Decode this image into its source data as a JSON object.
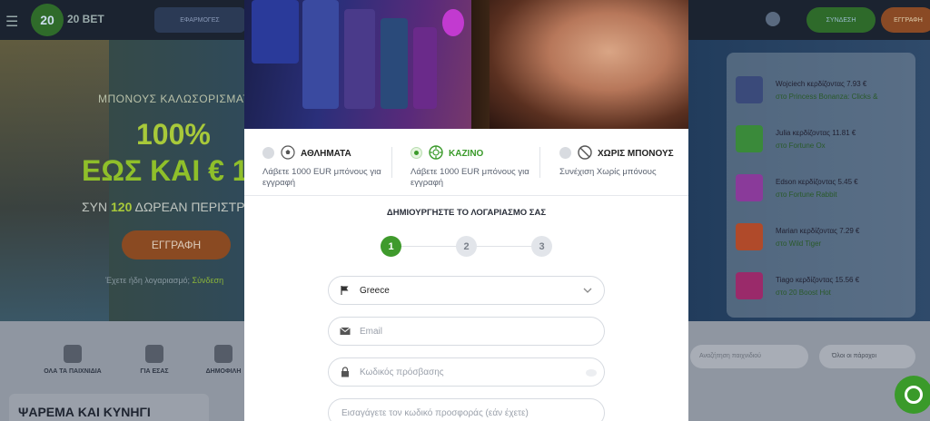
{
  "background": {
    "logo_text": "20 BET",
    "nav_label": "ΕΦΑΡΜΟΓΕΣ",
    "login_label": "ΣΥΝΔΕΣΗ",
    "register_label": "ΕΓΓΡΑΦΗ",
    "hero": {
      "title": "ΜΠΟΝΟΥΣ ΚΑΛΩΣΟΡΙΣΜΑΤΟΣ",
      "percent": "100%",
      "amount": "ΕΩΣ ΚΑΙ € 1",
      "spins_prefix": "ΣΥΝ",
      "spins_count": "120",
      "spins_suffix": "ΔΩΡΕΑΝ ΠΕΡΙΣΤΡΟ",
      "cta": "ΕΓΓΡΑΦΗ",
      "account_text": "Έχετε ήδη λογαριασμό;",
      "account_link": "Σύνδεση"
    },
    "winners": [
      {
        "line1": "Wojciech κερδίζοντας 7.93 €",
        "line2": "στο Princess Bonanza: Clicks &",
        "thumb_color": "#3a4a7a"
      },
      {
        "line1": "Julia κερδίζοντας 11.81 €",
        "line2": "στο Fortune Ox",
        "thumb_color": "#3a8a3a"
      },
      {
        "line1": "Edson κερδίζοντας 5.45 €",
        "line2": "στο Fortune Rabbit",
        "thumb_color": "#8a3a9a"
      },
      {
        "line1": "Marian κερδίζοντας 7.29 €",
        "line2": "στο Wild Tiger",
        "thumb_color": "#b04a2a"
      },
      {
        "line1": "Tiago κερδίζοντας 15.56 €",
        "line2": "στο 20 Boost Hot",
        "thumb_color": "#9a2a6a"
      }
    ],
    "categories": [
      "ΟΛΑ ΤΑ ΠΑΙΧΝΙΔΙΑ",
      "ΓΙΑ ΕΣΑΣ",
      "ΔΗΜΟΦΙΛΗ"
    ],
    "search_placeholder": "Αναζήτηση παιχνιδιού",
    "providers_label": "Όλοι οι πάροχοι",
    "section_title": "ΨΑΡΕΜΑ ΚΑΙ ΚΥΝΗΓΙ"
  },
  "modal": {
    "bonuses": [
      {
        "title": "ΑΘΛΗΜΑΤΑ",
        "desc": "Λάβετε 1000 EUR μπόνους για εγγραφή",
        "selected": false,
        "icon": "soccer-ball-icon"
      },
      {
        "title": "ΚΑΖΙΝΟ",
        "desc": "Λάβετε 1000 EUR μπόνους για εγγραφή",
        "selected": true,
        "icon": "casino-chip-icon"
      },
      {
        "title": "ΧΩΡΙΣ ΜΠΟΝΟΥΣ",
        "desc": "Συνέχιση Χωρίς μπόνους",
        "selected": false,
        "icon": "no-bonus-icon"
      }
    ],
    "form_title": "ΔΗΜΙΟΥΡΓΗΣΤΕ ΤΟ ΛΟΓΑΡΙΑΣΜΟ ΣΑΣ",
    "steps": [
      "1",
      "2",
      "3"
    ],
    "active_step": 1,
    "country_value": "Greece",
    "email_placeholder": "Email",
    "password_placeholder": "Κωδικός πρόσβασης",
    "promo_placeholder": "Εισαγάγετε τον κωδικό προσφοράς (εάν έχετε)"
  },
  "colors": {
    "accent_green": "#3f9a2c",
    "text_dark": "#222222",
    "muted": "#5a6270"
  }
}
